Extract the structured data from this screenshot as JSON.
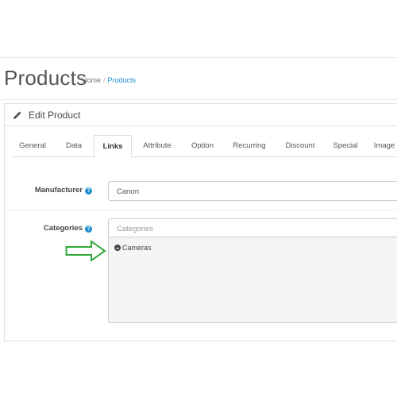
{
  "header": {
    "title": "Products",
    "breadcrumb": [
      {
        "label": "Home"
      },
      {
        "label": "Products"
      }
    ],
    "breadcrumb_separator": "/"
  },
  "panel": {
    "title": "Edit Product",
    "icon": "pencil-icon"
  },
  "tabs": [
    {
      "label": "General"
    },
    {
      "label": "Data"
    },
    {
      "label": "Links"
    },
    {
      "label": "Attribute"
    },
    {
      "label": "Option"
    },
    {
      "label": "Recurring"
    },
    {
      "label": "Discount"
    },
    {
      "label": "Special"
    },
    {
      "label": "Image"
    }
  ],
  "active_tab": "Links",
  "form": {
    "manufacturer": {
      "label": "Manufacturer",
      "value": "Canon",
      "help_icon": "?"
    },
    "categories": {
      "label": "Categories",
      "placeholder": "Categories",
      "help_icon": "?",
      "selected": [
        {
          "label": "Cameras"
        }
      ]
    }
  },
  "colors": {
    "accent": "#1e91cf",
    "annotation_arrow": "#2fa83a"
  }
}
